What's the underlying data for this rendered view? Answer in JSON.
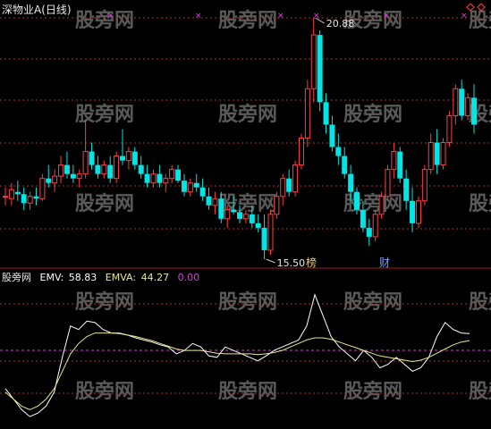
{
  "window": {
    "title": "深物业A(日线)"
  },
  "watermark": {
    "text": "股旁网"
  },
  "price_panel": {
    "high_label": "20.88",
    "low_label": "15.50",
    "event_marks": [
      "榜",
      "财"
    ],
    "icons": [
      "diamond-icon",
      "diamond-icon"
    ]
  },
  "indicator_panel": {
    "name": "股旁网",
    "emv_label": "EMV:",
    "emv_value": "58.83",
    "emva_label": "EMVA:",
    "emva_value": "44.27",
    "zero_value": "0.00"
  },
  "colors": {
    "background": "#000000",
    "up_candle": "#ff4040",
    "down_candle": "#00e5e5",
    "grid": "#b03030",
    "emv_line": "#ffffff",
    "emva_line": "#e8e88a",
    "zero_line": "#cc44cc",
    "marker": "#e040e0",
    "event_up": "#e8c878",
    "event_down": "#70a0ff",
    "watermark": "#5a5a5a"
  },
  "chart_data": [
    {
      "type": "candlestick",
      "title": "深物业A(日线)",
      "annotations": [
        "20.88",
        "15.50"
      ],
      "ohlc": [
        [
          16.9,
          17.1,
          16.7,
          16.9
        ],
        [
          16.85,
          17.2,
          16.7,
          17.05
        ],
        [
          17.0,
          17.25,
          16.8,
          16.95
        ],
        [
          16.95,
          17.1,
          16.6,
          16.75
        ],
        [
          16.75,
          17.0,
          16.6,
          16.9
        ],
        [
          16.9,
          17.1,
          16.7,
          16.85
        ],
        [
          16.85,
          17.4,
          16.8,
          17.3
        ],
        [
          17.3,
          17.6,
          17.1,
          17.2
        ],
        [
          17.2,
          17.5,
          17.0,
          17.35
        ],
        [
          17.35,
          17.8,
          17.2,
          17.6
        ],
        [
          17.6,
          17.9,
          17.3,
          17.4
        ],
        [
          17.4,
          17.6,
          17.2,
          17.3
        ],
        [
          17.3,
          17.5,
          17.1,
          17.4
        ],
        [
          17.4,
          18.6,
          17.3,
          17.9
        ],
        [
          17.9,
          18.1,
          17.5,
          17.6
        ],
        [
          17.6,
          17.8,
          17.3,
          17.4
        ],
        [
          17.4,
          17.7,
          17.3,
          17.6
        ],
        [
          17.6,
          17.8,
          17.2,
          17.3
        ],
        [
          17.3,
          17.9,
          17.2,
          17.8
        ],
        [
          17.8,
          18.4,
          17.6,
          17.7
        ],
        [
          17.7,
          18.0,
          17.5,
          17.9
        ],
        [
          17.9,
          18.0,
          17.5,
          17.6
        ],
        [
          17.6,
          17.8,
          17.3,
          17.4
        ],
        [
          17.4,
          17.6,
          17.1,
          17.2
        ],
        [
          17.2,
          17.5,
          17.1,
          17.4
        ],
        [
          17.4,
          17.6,
          17.1,
          17.2
        ],
        [
          17.2,
          17.4,
          17.0,
          17.3
        ],
        [
          17.3,
          17.6,
          17.2,
          17.5
        ],
        [
          17.5,
          17.6,
          17.2,
          17.25
        ],
        [
          17.25,
          17.4,
          16.9,
          17.0
        ],
        [
          17.0,
          17.3,
          16.9,
          17.2
        ],
        [
          17.2,
          17.4,
          17.0,
          17.1
        ],
        [
          17.1,
          17.3,
          16.8,
          16.9
        ],
        [
          16.9,
          17.1,
          16.6,
          16.7
        ],
        [
          16.7,
          17.0,
          16.5,
          16.85
        ],
        [
          16.85,
          17.0,
          16.3,
          16.4
        ],
        [
          16.4,
          16.7,
          16.2,
          16.6
        ],
        [
          16.6,
          16.9,
          16.5,
          16.55
        ],
        [
          16.55,
          16.7,
          16.3,
          16.4
        ],
        [
          16.4,
          16.6,
          16.3,
          16.5
        ],
        [
          16.5,
          16.7,
          16.2,
          16.3
        ],
        [
          16.3,
          16.5,
          16.1,
          16.2
        ],
        [
          16.2,
          16.5,
          15.5,
          15.7
        ],
        [
          15.7,
          16.6,
          15.6,
          16.5
        ],
        [
          16.5,
          17.0,
          16.4,
          16.9
        ],
        [
          16.9,
          17.4,
          16.7,
          17.3
        ],
        [
          17.3,
          17.5,
          16.9,
          17.0
        ],
        [
          17.0,
          17.7,
          16.9,
          17.6
        ],
        [
          17.6,
          18.3,
          17.5,
          18.2
        ],
        [
          18.2,
          19.5,
          18.0,
          19.3
        ],
        [
          19.3,
          20.88,
          19.0,
          20.5
        ],
        [
          20.5,
          20.6,
          18.8,
          19.0
        ],
        [
          19.0,
          19.2,
          18.3,
          18.5
        ],
        [
          18.5,
          18.7,
          17.9,
          18.0
        ],
        [
          18.0,
          18.3,
          17.6,
          17.8
        ],
        [
          17.8,
          18.0,
          17.3,
          17.4
        ],
        [
          17.4,
          17.6,
          16.8,
          17.0
        ],
        [
          17.0,
          17.1,
          16.5,
          16.6
        ],
        [
          16.6,
          16.8,
          16.1,
          16.2
        ],
        [
          16.2,
          16.4,
          15.8,
          16.0
        ],
        [
          16.0,
          16.6,
          15.9,
          16.5
        ],
        [
          16.5,
          17.0,
          16.4,
          16.9
        ],
        [
          16.9,
          17.6,
          16.8,
          17.5
        ],
        [
          17.5,
          18.1,
          17.3,
          17.9
        ],
        [
          17.9,
          18.0,
          17.2,
          17.3
        ],
        [
          17.3,
          17.5,
          16.6,
          16.8
        ],
        [
          16.8,
          17.1,
          16.1,
          16.3
        ],
        [
          16.3,
          16.9,
          16.2,
          16.8
        ],
        [
          16.8,
          17.6,
          16.7,
          17.5
        ],
        [
          17.5,
          18.3,
          17.4,
          18.1
        ],
        [
          18.1,
          18.4,
          17.4,
          17.6
        ],
        [
          17.6,
          18.2,
          17.5,
          18.1
        ],
        [
          18.1,
          18.8,
          18.0,
          18.7
        ],
        [
          18.7,
          19.4,
          18.5,
          19.3
        ],
        [
          19.3,
          19.5,
          18.6,
          18.7
        ],
        [
          18.7,
          19.2,
          18.6,
          19.1
        ],
        [
          19.1,
          19.4,
          18.3,
          18.5
        ]
      ]
    },
    {
      "type": "line",
      "title": "EMV",
      "series": [
        {
          "name": "EMV",
          "values": [
            -55,
            -70,
            -85,
            -95,
            -90,
            -80,
            -60,
            -10,
            35,
            30,
            42,
            40,
            30,
            25,
            25,
            22,
            18,
            15,
            12,
            8,
            5,
            -5,
            0,
            10,
            5,
            -8,
            -10,
            5,
            0,
            -5,
            -10,
            -15,
            -8,
            0,
            5,
            10,
            15,
            35,
            80,
            50,
            20,
            5,
            -5,
            -15,
            0,
            -10,
            -25,
            -20,
            -10,
            -20,
            -30,
            -25,
            -10,
            20,
            40,
            30,
            25,
            24
          ]
        },
        {
          "name": "EMVA",
          "values": [
            -60,
            -70,
            -80,
            -85,
            -80,
            -70,
            -55,
            -30,
            -5,
            10,
            20,
            25,
            25,
            25,
            24,
            22,
            20,
            17,
            14,
            10,
            6,
            2,
            0,
            0,
            0,
            -2,
            -4,
            -5,
            -5,
            -5,
            -5,
            -6,
            -5,
            -3,
            0,
            5,
            10,
            15,
            18,
            18,
            16,
            12,
            8,
            4,
            0,
            -4,
            -8,
            -10,
            -12,
            -14,
            -16,
            -14,
            -10,
            -4,
            2,
            8,
            12,
            14
          ]
        }
      ],
      "zero_value": 0.0
    }
  ]
}
